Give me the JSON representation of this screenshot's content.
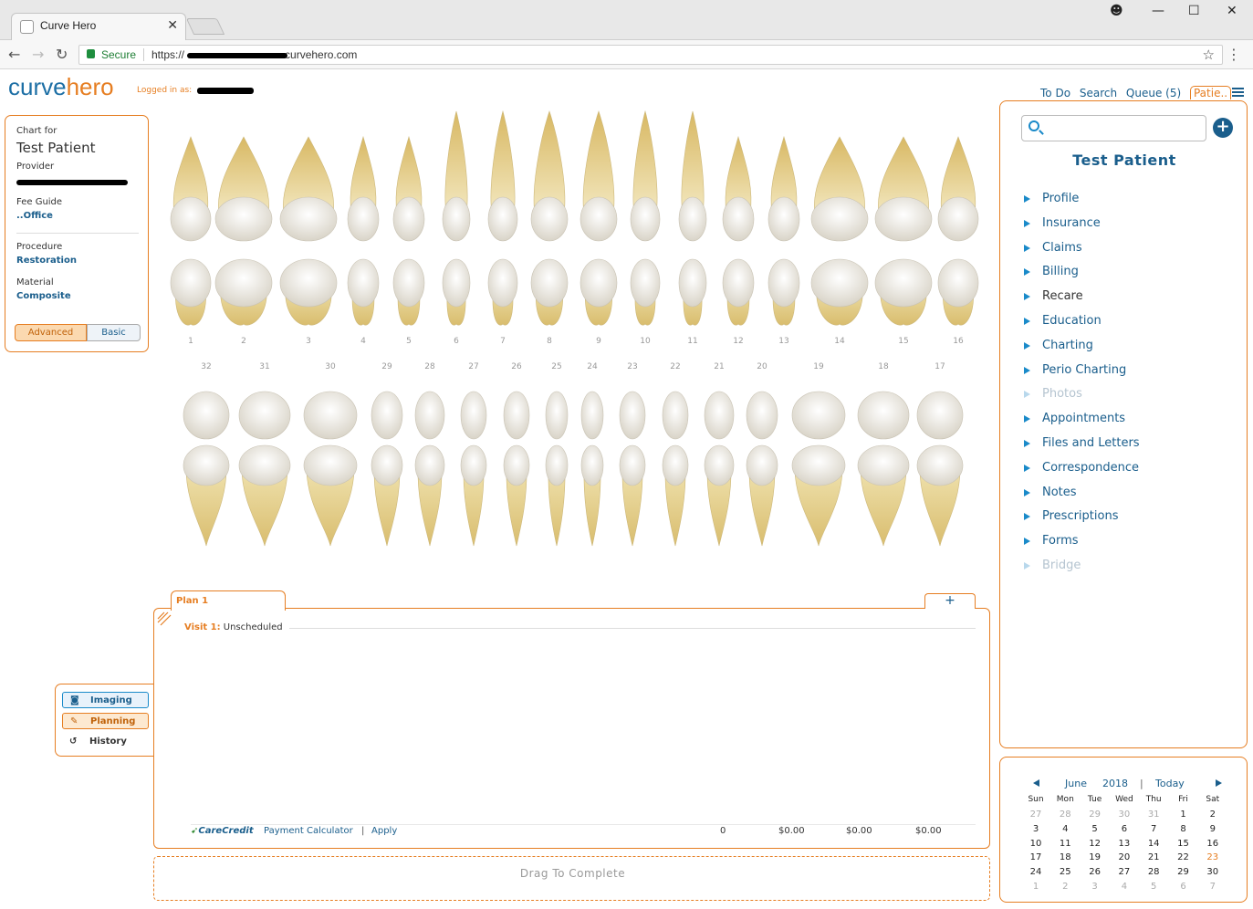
{
  "browser": {
    "tab_title": "Curve Hero",
    "secure_label": "Secure",
    "url_prefix": "https://",
    "url_domain": "curvehero.com"
  },
  "app": {
    "logo_part1": "curve",
    "logo_part2": "hero",
    "logged_in_label": "Logged in as:",
    "nav": [
      "To Do",
      "Search",
      "Queue (5)",
      "Patie.."
    ]
  },
  "chart_panel": {
    "chart_for_label": "Chart for",
    "patient_name": "Test Patient",
    "provider_label": "Provider",
    "fee_guide_label": "Fee Guide",
    "fee_guide_value": "..Office",
    "procedure_label": "Procedure",
    "procedure_value": "Restoration",
    "material_label": "Material",
    "material_value": "Composite",
    "advanced_label": "Advanced",
    "basic_label": "Basic"
  },
  "teeth": {
    "upper_numbers": [
      "1",
      "2",
      "3",
      "4",
      "5",
      "6",
      "7",
      "8",
      "9",
      "10",
      "11",
      "12",
      "13",
      "14",
      "15",
      "16"
    ],
    "lower_numbers": [
      "32",
      "31",
      "30",
      "29",
      "28",
      "27",
      "26",
      "25",
      "24",
      "23",
      "22",
      "21",
      "20",
      "19",
      "18",
      "17"
    ]
  },
  "side_panel": {
    "search_placeholder": "",
    "patient_title": "Test Patient",
    "menu": [
      {
        "label": "Profile",
        "state": "normal"
      },
      {
        "label": "Insurance",
        "state": "normal"
      },
      {
        "label": "Claims",
        "state": "normal"
      },
      {
        "label": "Billing",
        "state": "normal"
      },
      {
        "label": "Recare",
        "state": "dark"
      },
      {
        "label": "Education",
        "state": "normal"
      },
      {
        "label": "Charting",
        "state": "normal"
      },
      {
        "label": "Perio Charting",
        "state": "normal"
      },
      {
        "label": "Photos",
        "state": "disabled"
      },
      {
        "label": "Appointments",
        "state": "normal"
      },
      {
        "label": "Files and Letters",
        "state": "normal"
      },
      {
        "label": "Correspondence",
        "state": "normal"
      },
      {
        "label": "Notes",
        "state": "normal"
      },
      {
        "label": "Prescriptions",
        "state": "normal"
      },
      {
        "label": "Forms",
        "state": "normal"
      },
      {
        "label": "Bridge",
        "state": "disabled"
      }
    ]
  },
  "calendar": {
    "month": "June",
    "year": "2018",
    "separator": "|",
    "today_label": "Today",
    "weekdays": [
      "Sun",
      "Mon",
      "Tue",
      "Wed",
      "Thu",
      "Fri",
      "Sat"
    ],
    "weeks": [
      [
        [
          "27",
          1
        ],
        [
          "28",
          1
        ],
        [
          "29",
          1
        ],
        [
          "30",
          1
        ],
        [
          "31",
          1
        ],
        [
          "1",
          0
        ],
        [
          "2",
          0
        ]
      ],
      [
        [
          "3",
          0
        ],
        [
          "4",
          0
        ],
        [
          "5",
          0
        ],
        [
          "6",
          0
        ],
        [
          "7",
          0
        ],
        [
          "8",
          0
        ],
        [
          "9",
          0
        ]
      ],
      [
        [
          "10",
          0
        ],
        [
          "11",
          0
        ],
        [
          "12",
          0
        ],
        [
          "13",
          0
        ],
        [
          "14",
          0
        ],
        [
          "15",
          0
        ],
        [
          "16",
          0
        ]
      ],
      [
        [
          "17",
          0
        ],
        [
          "18",
          0
        ],
        [
          "19",
          0
        ],
        [
          "20",
          0
        ],
        [
          "21",
          0
        ],
        [
          "22",
          0
        ],
        [
          "23",
          2
        ]
      ],
      [
        [
          "24",
          0
        ],
        [
          "25",
          0
        ],
        [
          "26",
          0
        ],
        [
          "27",
          0
        ],
        [
          "28",
          0
        ],
        [
          "29",
          0
        ],
        [
          "30",
          0
        ]
      ],
      [
        [
          "1",
          1
        ],
        [
          "2",
          1
        ],
        [
          "3",
          1
        ],
        [
          "4",
          1
        ],
        [
          "5",
          1
        ],
        [
          "6",
          1
        ],
        [
          "7",
          1
        ]
      ]
    ]
  },
  "tools": {
    "imaging": "Imaging",
    "planning": "Planning",
    "history": "History"
  },
  "plan": {
    "tab_label": "Plan 1",
    "add_label": "+",
    "visit_label": "Visit 1:",
    "visit_status": "Unscheduled",
    "carecredit_label": "CareCredit",
    "payment_calc": "Payment Calculator",
    "separator": "|",
    "apply": "Apply",
    "total_count": "0",
    "total1": "$0.00",
    "total2": "$0.00",
    "total3": "$0.00",
    "drag_label": "Drag To Complete"
  }
}
